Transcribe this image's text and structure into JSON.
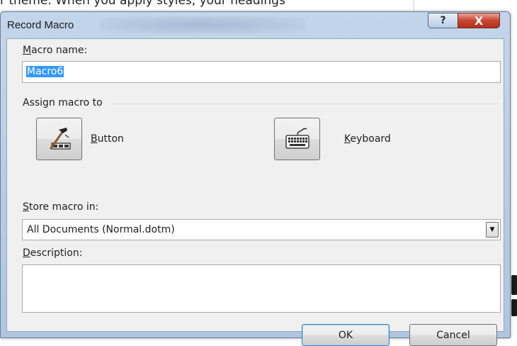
{
  "background": {
    "partial_text": "r theme. When you apply styles, your headings"
  },
  "dialog": {
    "title": "Record Macro",
    "help_glyph": "?",
    "close_glyph": "X",
    "macro_name": {
      "label_accel": "M",
      "label_rest": "acro name:",
      "value": "Macro6"
    },
    "assign_group_label": "Assign macro to",
    "button_option": {
      "label_accel": "B",
      "label_rest": "utton",
      "icon": "hammer-toolbar-icon"
    },
    "keyboard_option": {
      "label_accel": "K",
      "label_rest": "eyboard",
      "icon": "keyboard-icon"
    },
    "store_in": {
      "label_accel": "S",
      "label_rest": "tore macro in:",
      "value": "All Documents (Normal.dotm)",
      "arrow": "▼"
    },
    "description": {
      "label_accel": "D",
      "label_rest": "escription:",
      "value": ""
    },
    "ok_label": "OK",
    "cancel_label": "Cancel"
  },
  "colors": {
    "frame": "#aec6e0",
    "client": "#f0f0f0",
    "selection": "#3399ff",
    "close_button": "#c8452f",
    "default_button_border": "#3c7fb1"
  }
}
